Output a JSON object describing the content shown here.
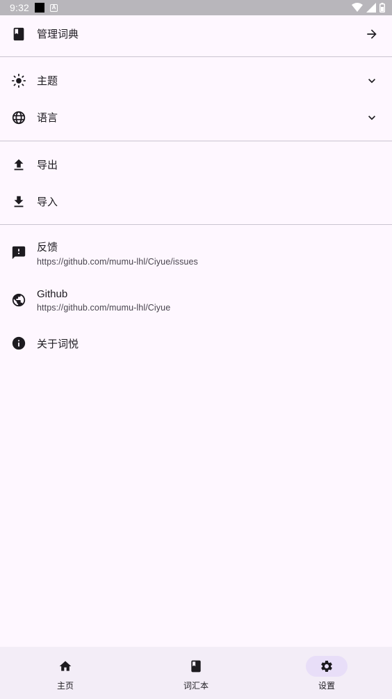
{
  "status_bar": {
    "time": "9:32"
  },
  "items": {
    "manage_dict": "管理词典",
    "theme": "主题",
    "language": "语言",
    "export": "导出",
    "import": "导入",
    "feedback": "反馈",
    "feedback_url": "https://github.com/mumu-lhl/Ciyue/issues",
    "github": "Github",
    "github_url": "https://github.com/mumu-lhl/Ciyue",
    "about": "关于词悦"
  },
  "nav": {
    "home": "主页",
    "wordbook": "词汇本",
    "settings": "设置",
    "active": "settings"
  },
  "colors": {
    "background": "#fef7ff",
    "nav_background": "#f3edf7",
    "active_indicator": "#e8def8",
    "icon": "#49454f",
    "divider": "#cac4d0"
  }
}
